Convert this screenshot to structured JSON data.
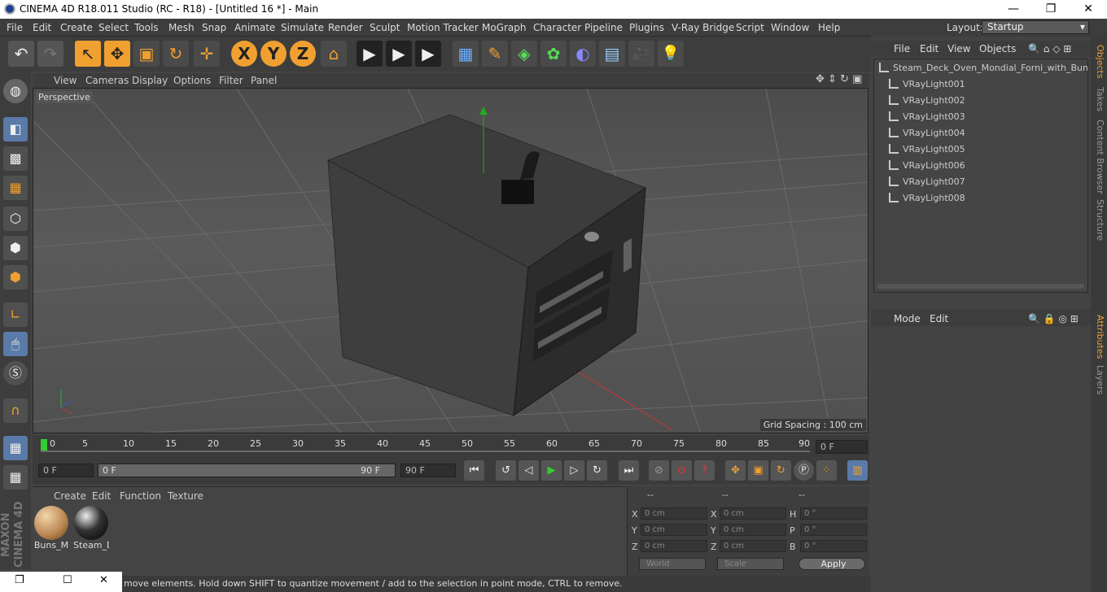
{
  "titlebar": {
    "title": "CINEMA 4D R18.011 Studio (RC - R18) - [Untitled 16 *] - Main",
    "min": "—",
    "max": "❐",
    "close": "✕"
  },
  "menu": [
    "File",
    "Edit",
    "Create",
    "Select",
    "Tools",
    "Mesh",
    "Snap",
    "Animate",
    "Simulate",
    "Render",
    "Sculpt",
    "Motion Tracker",
    "MoGraph",
    "Character",
    "Pipeline",
    "Plugins",
    "V-Ray Bridge",
    "Script",
    "Window",
    "Help"
  ],
  "layout": {
    "label": "Layout:",
    "value": "Startup"
  },
  "toolbar": {
    "undo": "↶",
    "redo": "↷",
    "select": "↖",
    "move": "✥",
    "scale": "▣",
    "rotate": "↻",
    "add": "✛",
    "x": "X",
    "y": "Y",
    "z": "Z",
    "coord": "⌂",
    "render1": "▶",
    "render2": "▶",
    "render3": "▶",
    "cube": "▦",
    "pen": "✎",
    "gen": "◈",
    "clone": "✿",
    "deform": "◐",
    "floor": "▤",
    "camera": "🎥",
    "light": "💡"
  },
  "viewport": {
    "menu": [
      "View",
      "Cameras",
      "Display",
      "Options",
      "Filter",
      "Panel"
    ],
    "label": "Perspective",
    "grid_spacing": "Grid Spacing : 100 cm"
  },
  "timeline": {
    "ticks": [
      "0",
      "5",
      "10",
      "15",
      "20",
      "25",
      "30",
      "35",
      "40",
      "45",
      "50",
      "55",
      "60",
      "65",
      "70",
      "75",
      "80",
      "85",
      "90"
    ],
    "current": "0 F"
  },
  "playbar": {
    "start": "0 F",
    "range_start": "0 F",
    "range_end": "90 F",
    "end": "90 F"
  },
  "materials": {
    "menu": [
      "Create",
      "Edit",
      "Function",
      "Texture"
    ],
    "items": [
      {
        "name": "Buns_M"
      },
      {
        "name": "Steam_D"
      }
    ]
  },
  "coords": {
    "headers": [
      "--",
      "--",
      "--"
    ],
    "rows": [
      {
        "a": "X",
        "av": "0 cm",
        "b": "X",
        "bv": "0 cm",
        "c": "H",
        "cv": "0 °"
      },
      {
        "a": "Y",
        "av": "0 cm",
        "b": "Y",
        "bv": "0 cm",
        "c": "P",
        "cv": "0 °"
      },
      {
        "a": "Z",
        "av": "0 cm",
        "b": "Z",
        "bv": "0 cm",
        "c": "B",
        "cv": "0 °"
      }
    ],
    "mode": "World",
    "scale": "Scale",
    "apply": "Apply"
  },
  "status": {
    "message": "move elements. Hold down SHIFT to quantize movement / add to the selection in point mode, CTRL to remove."
  },
  "objects": {
    "menu": [
      "File",
      "Edit",
      "View",
      "Objects"
    ],
    "items": [
      "Steam_Deck_Oven_Mondial_Forni_with_Buns",
      "VRayLight001",
      "VRayLight002",
      "VRayLight003",
      "VRayLight004",
      "VRayLight005",
      "VRayLight006",
      "VRayLight007",
      "VRayLight008"
    ]
  },
  "attributes": {
    "menu": [
      "Mode",
      "Edit"
    ]
  },
  "sidetabs": [
    "Objects",
    "Takes",
    "Content Browser",
    "Structure",
    "Attributes",
    "Layers"
  ]
}
